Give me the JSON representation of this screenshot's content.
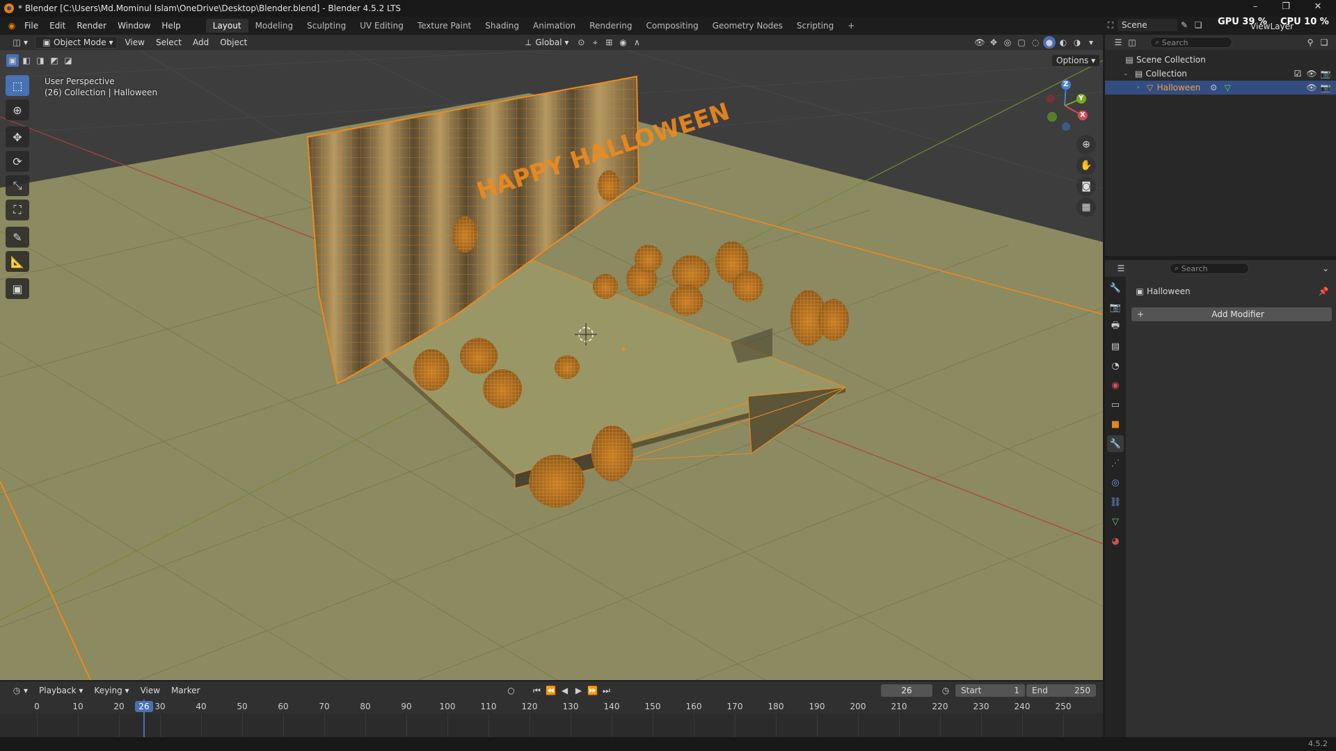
{
  "window": {
    "title": "* Blender [C:\\Users\\Md.Mominul Islam\\OneDrive\\Desktop\\Blender.blend] - Blender 4.5.2 LTS",
    "minimize": "–",
    "maximize": "❐",
    "close": "✕"
  },
  "menu": [
    "File",
    "Edit",
    "Render",
    "Window",
    "Help"
  ],
  "workspaces": [
    "Layout",
    "Modeling",
    "Sculpting",
    "UV Editing",
    "Texture Paint",
    "Shading",
    "Animation",
    "Rendering",
    "Compositing",
    "Geometry Nodes",
    "Scripting"
  ],
  "workspace_add": "+",
  "scene": {
    "label": "Scene",
    "view_layer": "ViewLayer"
  },
  "stats": {
    "gpu_label": "GPU",
    "gpu_value": "39 %",
    "cpu_label": "CPU",
    "cpu_value": "10 %"
  },
  "viewport_header": {
    "mode": "Object Mode",
    "menus": [
      "View",
      "Select",
      "Add",
      "Object"
    ],
    "orientation": "Global",
    "options": "Options"
  },
  "viewport": {
    "perspective": "User Perspective",
    "collection_info": "(26) Collection | Halloween",
    "scene_text": "HAPPY HALLOWEEN",
    "colors": {
      "floor": "#8c8a60",
      "grid": "#6d6c4e",
      "wire": "#f08a1c",
      "x_axis": "#b0403f",
      "y_axis": "#6e8f2f",
      "bg": "#3d3d3d"
    },
    "gizmo": {
      "z": "Z",
      "y": "Y",
      "x": "X"
    }
  },
  "outliner": {
    "search_placeholder": "Search",
    "scene_collection": "Scene Collection",
    "collection": "Collection",
    "object": "Halloween"
  },
  "properties": {
    "search_placeholder": "Search",
    "object_name": "Halloween",
    "add_modifier": "Add Modifier"
  },
  "timeline": {
    "menus": [
      "Playback",
      "Keying",
      "View",
      "Marker"
    ],
    "current_frame": "26",
    "start_label": "Start",
    "start_value": "1",
    "end_label": "End",
    "end_value": "250",
    "ticks": [
      "0",
      "10",
      "20",
      "30",
      "40",
      "50",
      "60",
      "70",
      "80",
      "90",
      "100",
      "110",
      "120",
      "130",
      "140",
      "150",
      "160",
      "170",
      "180",
      "190",
      "200",
      "210",
      "220",
      "230",
      "240",
      "250"
    ]
  },
  "status": {
    "version": "4.5.2"
  }
}
